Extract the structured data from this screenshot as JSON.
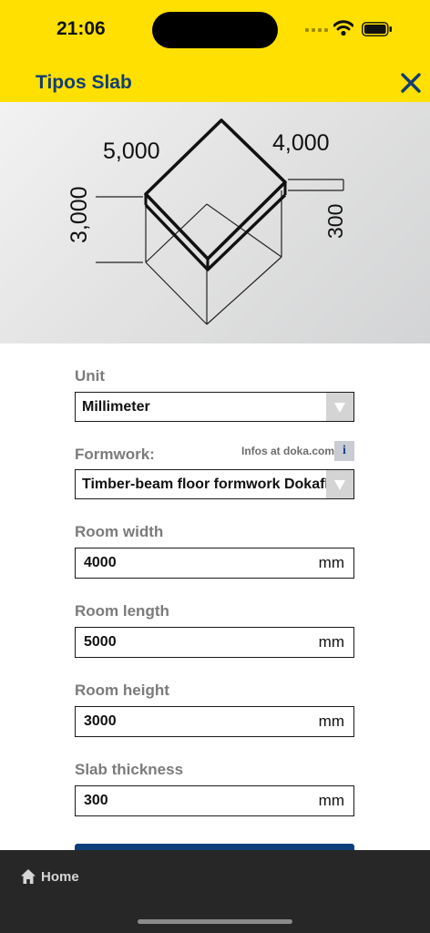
{
  "status_bar": {
    "time": "21:06"
  },
  "header": {
    "title": "Tipos Slab"
  },
  "diagram": {
    "length": "5,000",
    "width": "4,000",
    "height": "3,000",
    "thickness": "300"
  },
  "form": {
    "unit": {
      "label": "Unit",
      "value": "Millimeter"
    },
    "formwork": {
      "label": "Formwork:",
      "info_link": "Infos at doka.com",
      "info_icon": "i",
      "value": "Timber-beam floor formwork Dokaflex"
    },
    "room_width": {
      "label": "Room width",
      "value": "4000",
      "unit": "mm"
    },
    "room_length": {
      "label": "Room length",
      "value": "5000",
      "unit": "mm"
    },
    "room_height": {
      "label": "Room height",
      "value": "3000",
      "unit": "mm"
    },
    "slab_thickness": {
      "label": "Slab thickness",
      "value": "300",
      "unit": "mm"
    }
  },
  "bottom_nav": {
    "home_label": "Home"
  },
  "colors": {
    "header_bg": "#ffe000",
    "title": "#123e73",
    "bottom_bar": "#272727",
    "primary_button": "#0f3f7a"
  }
}
